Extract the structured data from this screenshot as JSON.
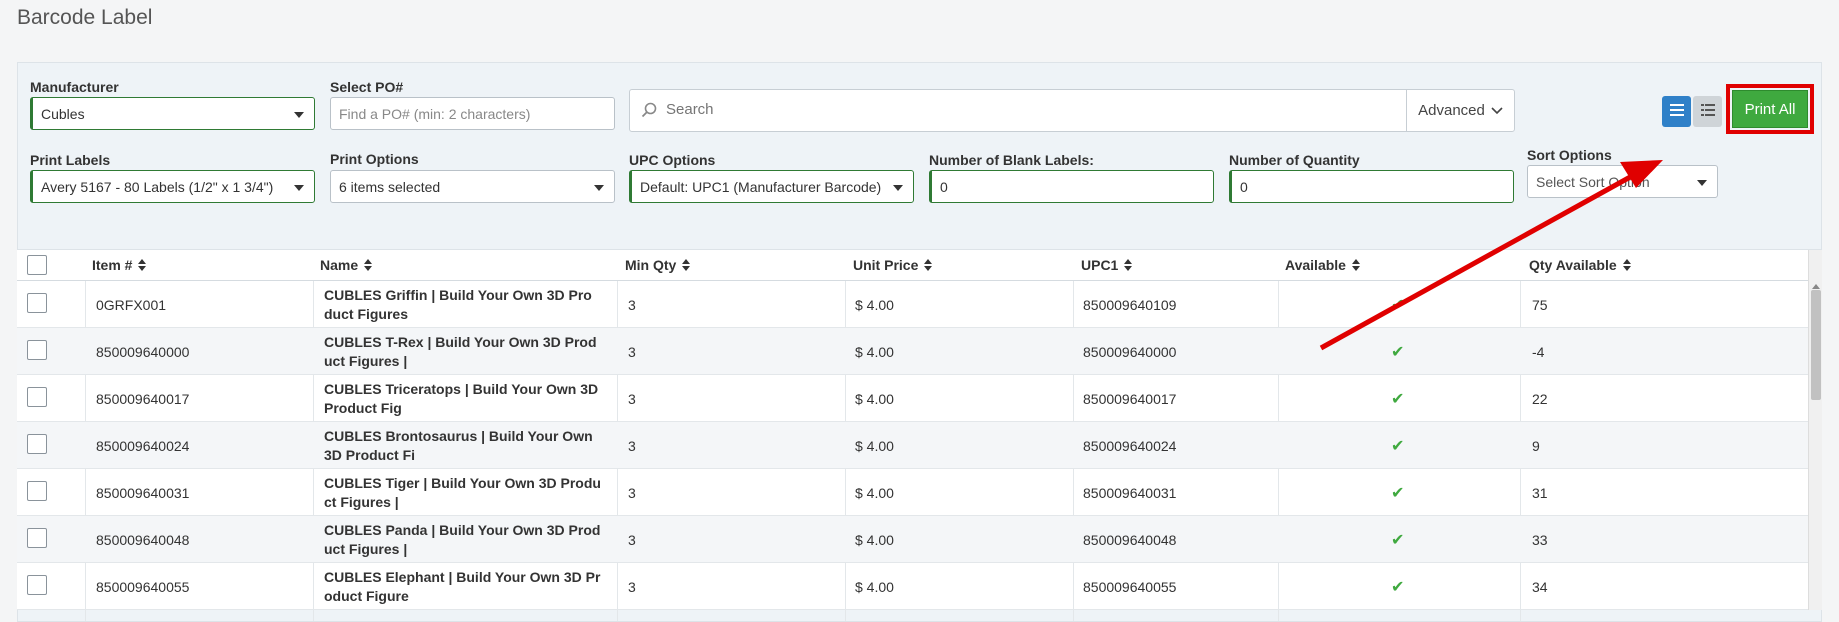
{
  "page": {
    "title": "Barcode Label"
  },
  "filters": {
    "manufacturer": {
      "label": "Manufacturer",
      "value": "Cubles"
    },
    "po": {
      "label": "Select PO#",
      "placeholder": "Find a PO# (min: 2 characters)"
    },
    "search": {
      "placeholder": "Search",
      "advanced_label": "Advanced"
    },
    "print_labels": {
      "label": "Print Labels",
      "value": "Avery 5167 - 80 Labels (1/2\" x 1 3/4\")"
    },
    "print_options": {
      "label": "Print Options",
      "value": "6 items selected"
    },
    "upc_options": {
      "label": "UPC Options",
      "value": "Default: UPC1 (Manufacturer Barcode)"
    },
    "blank_labels": {
      "label": "Number of Blank Labels:",
      "value": "0"
    },
    "quantity": {
      "label": "Number of Quantity",
      "value": "0"
    },
    "sort_options": {
      "label": "Sort Options",
      "placeholder": "Select Sort Option"
    }
  },
  "toolbar": {
    "print_all_label": "Print All"
  },
  "colors": {
    "accent_green": "#3fa93f",
    "view_blue": "#2f80c8",
    "highlight_red": "#e00000"
  },
  "table": {
    "columns": [
      "Item #",
      "Name",
      "Min Qty",
      "Unit Price",
      "UPC1",
      "Available",
      "Qty Available"
    ],
    "rows": [
      {
        "item": "0GRFX001",
        "name": "CUBLES Griffin | Build Your Own 3D Pro\nduct Figures",
        "min_qty": "3",
        "price": "$ 4.00",
        "upc": "850009640109",
        "available": "✔",
        "qty": "75"
      },
      {
        "item": "850009640000",
        "name": "CUBLES T-Rex | Build Your Own 3D Prod\nuct Figures |",
        "min_qty": "3",
        "price": "$ 4.00",
        "upc": "850009640000",
        "available": "✔",
        "qty": "-4"
      },
      {
        "item": "850009640017",
        "name": "CUBLES Triceratops | Build Your Own 3D\nProduct Fig",
        "min_qty": "3",
        "price": "$ 4.00",
        "upc": "850009640017",
        "available": "✔",
        "qty": "22"
      },
      {
        "item": "850009640024",
        "name": "CUBLES Brontosaurus | Build Your Own\n3D Product Fi",
        "min_qty": "3",
        "price": "$ 4.00",
        "upc": "850009640024",
        "available": "✔",
        "qty": "9"
      },
      {
        "item": "850009640031",
        "name": "CUBLES Tiger | Build Your Own 3D Produ\nct Figures |",
        "min_qty": "3",
        "price": "$ 4.00",
        "upc": "850009640031",
        "available": "✔",
        "qty": "31"
      },
      {
        "item": "850009640048",
        "name": "CUBLES Panda | Build Your Own 3D Prod\nuct Figures |",
        "min_qty": "3",
        "price": "$ 4.00",
        "upc": "850009640048",
        "available": "✔",
        "qty": "33"
      },
      {
        "item": "850009640055",
        "name": "CUBLES Elephant | Build Your Own 3D Pr\noduct Figure",
        "min_qty": "3",
        "price": "$ 4.00",
        "upc": "850009640055",
        "available": "✔",
        "qty": "34"
      }
    ]
  }
}
